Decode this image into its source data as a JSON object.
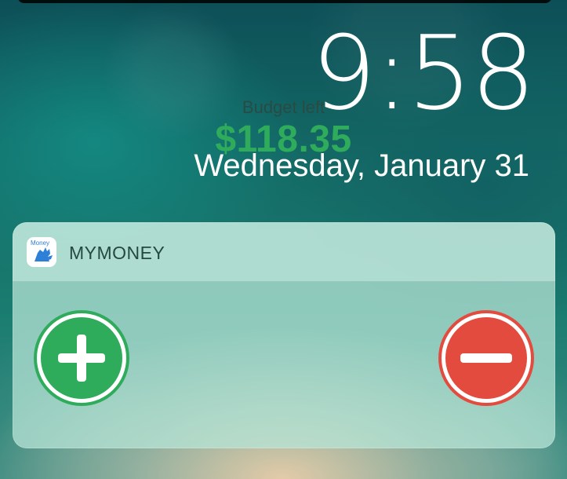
{
  "lockscreen": {
    "time": "9:58",
    "date": "Wednesday, January 31"
  },
  "widget": {
    "app_name": "MYMONEY",
    "icon_text": "Money",
    "budget_label": "Budget left",
    "budget_value": "$118.35"
  },
  "colors": {
    "add_button": "#2fac5b",
    "subtract_button": "#e34b3f",
    "budget_value": "#2fac5b"
  },
  "icons": {
    "add": "plus-icon",
    "subtract": "minus-icon",
    "app": "mymoney-fox-icon"
  }
}
